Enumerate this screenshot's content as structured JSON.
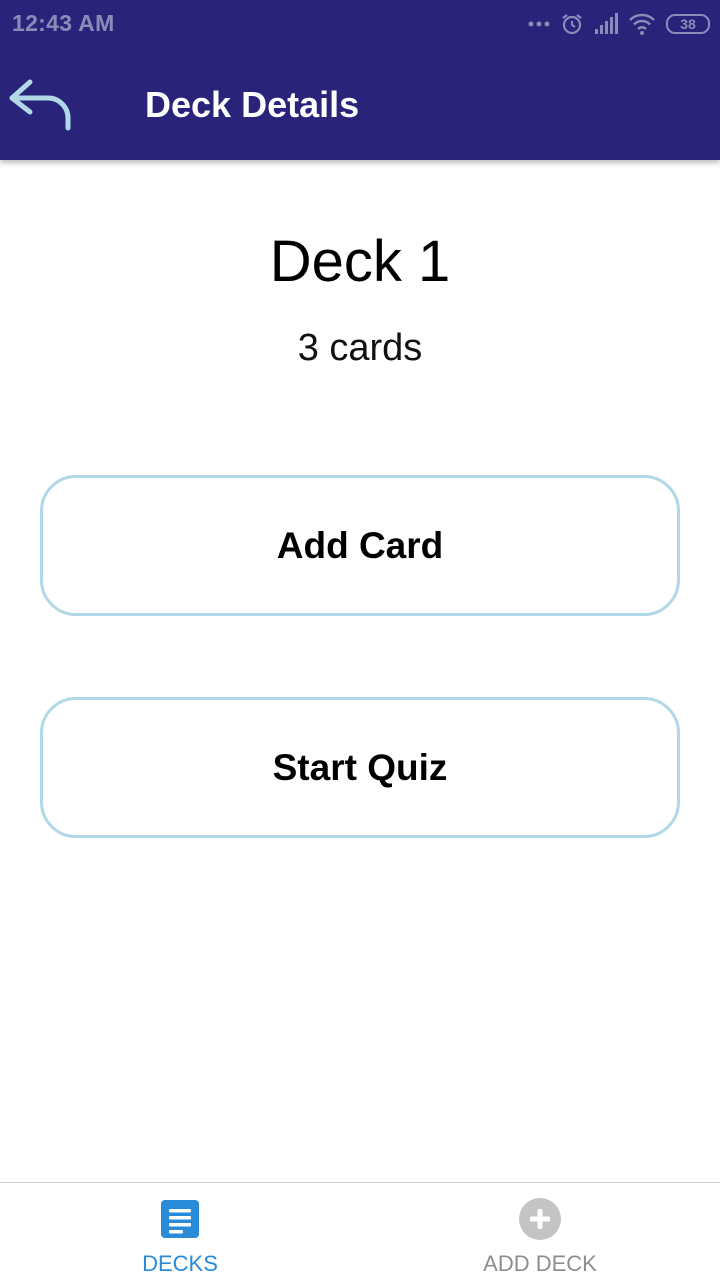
{
  "status_bar": {
    "time": "12:43 AM",
    "battery": "38",
    "icons": [
      "more-dots-icon",
      "alarm-icon",
      "signal-icon",
      "wifi-icon",
      "battery-icon"
    ]
  },
  "header": {
    "title": "Deck Details",
    "back_icon": "back-arrow-icon"
  },
  "deck": {
    "title": "Deck 1",
    "card_count": "3 cards"
  },
  "actions": {
    "add_card": "Add Card",
    "start_quiz": "Start Quiz"
  },
  "tabs": [
    {
      "label": "DECKS",
      "icon": "deck-list-icon",
      "active": true
    },
    {
      "label": "ADD DECK",
      "icon": "add-circle-icon",
      "active": false
    }
  ],
  "colors": {
    "header_bg": "#29247a",
    "button_border": "#b0d8e6",
    "tab_active": "#2a8bd8",
    "tab_inactive": "#8e8e8e"
  }
}
